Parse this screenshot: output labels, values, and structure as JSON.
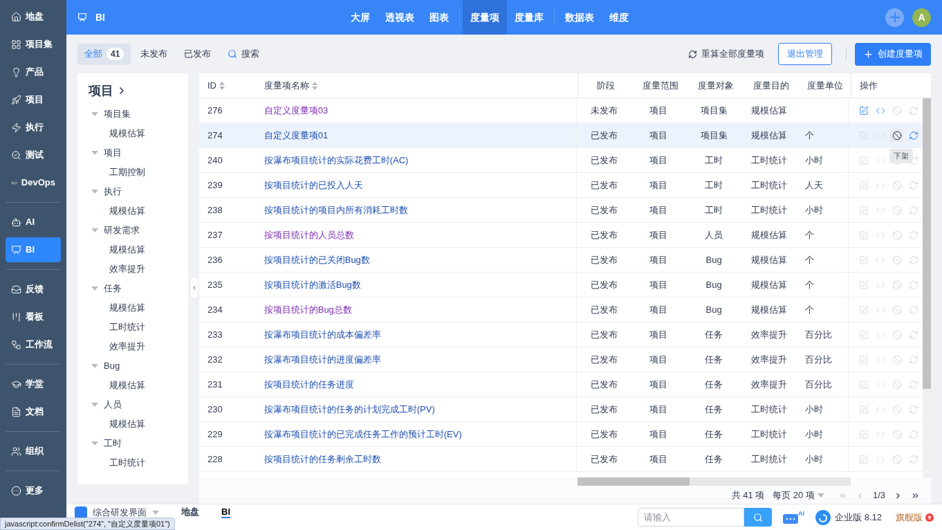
{
  "nav_groups": [
    [
      {
        "label": "地盘",
        "selected": false
      },
      {
        "label": "项目集",
        "selected": false
      },
      {
        "label": "产品",
        "selected": false
      },
      {
        "label": "项目",
        "selected": false
      },
      {
        "label": "执行",
        "selected": false
      },
      {
        "label": "测试",
        "selected": false
      },
      {
        "label": "DevOps",
        "selected": false
      }
    ],
    [
      {
        "label": "AI",
        "selected": false
      },
      {
        "label": "BI",
        "selected": true
      }
    ],
    [
      {
        "label": "反馈",
        "selected": false
      },
      {
        "label": "看板",
        "selected": false
      },
      {
        "label": "工作流",
        "selected": false
      }
    ],
    [
      {
        "label": "学堂",
        "selected": false
      },
      {
        "label": "文档",
        "selected": false
      }
    ],
    [
      {
        "label": "组织",
        "selected": false
      }
    ],
    [
      {
        "label": "更多",
        "selected": false
      }
    ]
  ],
  "header": {
    "title": "BI",
    "tab_groups": [
      [
        {
          "label": "大屏",
          "selected": false
        },
        {
          "label": "透视表",
          "selected": false
        },
        {
          "label": "图表",
          "selected": false
        }
      ],
      [
        {
          "label": "度量项",
          "selected": true
        },
        {
          "label": "度量库",
          "selected": false
        }
      ],
      [
        {
          "label": "数据表",
          "selected": false
        },
        {
          "label": "维度",
          "selected": false
        }
      ]
    ],
    "avatar": "A"
  },
  "filters": [
    {
      "label": "全部",
      "count": "41",
      "selected": true
    },
    {
      "label": "未发布",
      "selected": false
    },
    {
      "label": "已发布",
      "selected": false
    }
  ],
  "search_label": "搜索",
  "actions": {
    "recalc": "重算全部度量项",
    "exit": "退出管理",
    "create": "创建度量项"
  },
  "tree": {
    "title": "项目",
    "items": [
      {
        "label": "项目集",
        "children": [
          {
            "label": "规模估算"
          }
        ]
      },
      {
        "label": "项目",
        "children": [
          {
            "label": "工期控制"
          }
        ]
      },
      {
        "label": "执行",
        "children": [
          {
            "label": "规模估算"
          }
        ]
      },
      {
        "label": "研发需求",
        "children": [
          {
            "label": "规模估算"
          },
          {
            "label": "效率提升"
          }
        ]
      },
      {
        "label": "任务",
        "children": [
          {
            "label": "规模估算"
          },
          {
            "label": "工时统计"
          },
          {
            "label": "效率提升"
          }
        ]
      },
      {
        "label": "Bug",
        "children": [
          {
            "label": "规模估算"
          }
        ]
      },
      {
        "label": "人员",
        "children": [
          {
            "label": "规模估算"
          }
        ]
      },
      {
        "label": "工时",
        "children": [
          {
            "label": "工时统计"
          }
        ]
      }
    ]
  },
  "table": {
    "columns": [
      {
        "label": "ID",
        "sortable": true
      },
      {
        "label": "度量项名称",
        "sortable": true
      },
      {
        "label": "阶段",
        "sortable": false
      },
      {
        "label": "度量范围",
        "sortable": false
      },
      {
        "label": "度量对象",
        "sortable": false
      },
      {
        "label": "度量目的",
        "sortable": false
      },
      {
        "label": "度量单位",
        "sortable": false
      },
      {
        "label": "操作",
        "sortable": false
      }
    ],
    "rows": [
      {
        "id": "276",
        "name": "自定义度量项03",
        "visited": true,
        "stage": "未发布",
        "scope": "项目",
        "object": "项目集",
        "purpose": "规模估算",
        "unit": "",
        "hovered": false,
        "actions": [
          {
            "kind": "edit",
            "enabled": true
          },
          {
            "kind": "code",
            "enabled": true
          },
          {
            "kind": "delist",
            "enabled": false
          },
          {
            "kind": "recalc",
            "enabled": false
          }
        ]
      },
      {
        "id": "274",
        "name": "自定义度量项01",
        "visited": false,
        "stage": "已发布",
        "scope": "项目",
        "object": "项目集",
        "purpose": "规模估算",
        "unit": "个",
        "hovered": true,
        "actions": [
          {
            "kind": "edit",
            "enabled": false
          },
          {
            "kind": "code",
            "enabled": false
          },
          {
            "kind": "delist",
            "enabled": true,
            "tooltip": "下架"
          },
          {
            "kind": "recalc",
            "enabled": true
          }
        ]
      },
      {
        "id": "240",
        "name": "按瀑布项目统计的实际花费工时(AC)",
        "visited": false,
        "stage": "已发布",
        "scope": "项目",
        "object": "工时",
        "purpose": "工时统计",
        "unit": "小时",
        "hovered": false,
        "actions": [
          {
            "kind": "edit",
            "enabled": false
          },
          {
            "kind": "code",
            "enabled": false
          },
          {
            "kind": "delist",
            "enabled": false
          },
          {
            "kind": "recalc",
            "enabled": false
          }
        ]
      },
      {
        "id": "239",
        "name": "按项目统计的已投入人天",
        "visited": false,
        "stage": "已发布",
        "scope": "项目",
        "object": "工时",
        "purpose": "工时统计",
        "unit": "人天",
        "hovered": false,
        "actions": [
          {
            "kind": "edit",
            "enabled": false
          },
          {
            "kind": "code",
            "enabled": false
          },
          {
            "kind": "delist",
            "enabled": false
          },
          {
            "kind": "recalc",
            "enabled": false
          }
        ]
      },
      {
        "id": "238",
        "name": "按项目统计的项目内所有消耗工时数",
        "visited": false,
        "stage": "已发布",
        "scope": "项目",
        "object": "工时",
        "purpose": "工时统计",
        "unit": "小时",
        "hovered": false,
        "actions": [
          {
            "kind": "edit",
            "enabled": false
          },
          {
            "kind": "code",
            "enabled": false
          },
          {
            "kind": "delist",
            "enabled": false
          },
          {
            "kind": "recalc",
            "enabled": false
          }
        ]
      },
      {
        "id": "237",
        "name": "按项目统计的人员总数",
        "visited": true,
        "stage": "已发布",
        "scope": "项目",
        "object": "人员",
        "purpose": "规模估算",
        "unit": "个",
        "hovered": false,
        "actions": [
          {
            "kind": "edit",
            "enabled": false
          },
          {
            "kind": "code",
            "enabled": false
          },
          {
            "kind": "delist",
            "enabled": false
          },
          {
            "kind": "recalc",
            "enabled": false
          }
        ]
      },
      {
        "id": "236",
        "name": "按项目统计的已关闭Bug数",
        "visited": false,
        "stage": "已发布",
        "scope": "项目",
        "object": "Bug",
        "purpose": "规模估算",
        "unit": "个",
        "hovered": false,
        "actions": [
          {
            "kind": "edit",
            "enabled": false
          },
          {
            "kind": "code",
            "enabled": false
          },
          {
            "kind": "delist",
            "enabled": false
          },
          {
            "kind": "recalc",
            "enabled": false
          }
        ]
      },
      {
        "id": "235",
        "name": "按项目统计的激活Bug数",
        "visited": false,
        "stage": "已发布",
        "scope": "项目",
        "object": "Bug",
        "purpose": "规模估算",
        "unit": "个",
        "hovered": false,
        "actions": [
          {
            "kind": "edit",
            "enabled": false
          },
          {
            "kind": "code",
            "enabled": false
          },
          {
            "kind": "delist",
            "enabled": false
          },
          {
            "kind": "recalc",
            "enabled": false
          }
        ]
      },
      {
        "id": "234",
        "name": "按项目统计的Bug总数",
        "visited": true,
        "stage": "已发布",
        "scope": "项目",
        "object": "Bug",
        "purpose": "规模估算",
        "unit": "个",
        "hovered": false,
        "actions": [
          {
            "kind": "edit",
            "enabled": false
          },
          {
            "kind": "code",
            "enabled": false
          },
          {
            "kind": "delist",
            "enabled": false
          },
          {
            "kind": "recalc",
            "enabled": false
          }
        ]
      },
      {
        "id": "233",
        "name": "按瀑布项目统计的成本偏差率",
        "visited": false,
        "stage": "已发布",
        "scope": "项目",
        "object": "任务",
        "purpose": "效率提升",
        "unit": "百分比",
        "hovered": false,
        "actions": [
          {
            "kind": "edit",
            "enabled": false
          },
          {
            "kind": "code",
            "enabled": false
          },
          {
            "kind": "delist",
            "enabled": false
          },
          {
            "kind": "recalc",
            "enabled": false
          }
        ]
      },
      {
        "id": "232",
        "name": "按瀑布项目统计的进度偏差率",
        "visited": false,
        "stage": "已发布",
        "scope": "项目",
        "object": "任务",
        "purpose": "效率提升",
        "unit": "百分比",
        "hovered": false,
        "actions": [
          {
            "kind": "edit",
            "enabled": false
          },
          {
            "kind": "code",
            "enabled": false
          },
          {
            "kind": "delist",
            "enabled": false
          },
          {
            "kind": "recalc",
            "enabled": false
          }
        ]
      },
      {
        "id": "231",
        "name": "按项目统计的任务进度",
        "visited": false,
        "stage": "已发布",
        "scope": "项目",
        "object": "任务",
        "purpose": "效率提升",
        "unit": "百分比",
        "hovered": false,
        "actions": [
          {
            "kind": "edit",
            "enabled": false
          },
          {
            "kind": "code",
            "enabled": false
          },
          {
            "kind": "delist",
            "enabled": false
          },
          {
            "kind": "recalc",
            "enabled": false
          }
        ]
      },
      {
        "id": "230",
        "name": "按瀑布项目统计的任务的计划完成工时(PV)",
        "visited": false,
        "stage": "已发布",
        "scope": "项目",
        "object": "任务",
        "purpose": "工时统计",
        "unit": "小时",
        "hovered": false,
        "actions": [
          {
            "kind": "edit",
            "enabled": false
          },
          {
            "kind": "code",
            "enabled": false
          },
          {
            "kind": "delist",
            "enabled": false
          },
          {
            "kind": "recalc",
            "enabled": false
          }
        ]
      },
      {
        "id": "229",
        "name": "按瀑布项目统计的已完成任务工作的预计工时(EV)",
        "visited": false,
        "stage": "已发布",
        "scope": "项目",
        "object": "任务",
        "purpose": "工时统计",
        "unit": "小时",
        "hovered": false,
        "actions": [
          {
            "kind": "edit",
            "enabled": false
          },
          {
            "kind": "code",
            "enabled": false
          },
          {
            "kind": "delist",
            "enabled": false
          },
          {
            "kind": "recalc",
            "enabled": false
          }
        ]
      },
      {
        "id": "228",
        "name": "按项目统计的任务剩余工时数",
        "visited": false,
        "stage": "已发布",
        "scope": "项目",
        "object": "任务",
        "purpose": "工时统计",
        "unit": "小时",
        "hovered": false,
        "actions": [
          {
            "kind": "edit",
            "enabled": false
          },
          {
            "kind": "code",
            "enabled": false
          },
          {
            "kind": "delist",
            "enabled": false
          },
          {
            "kind": "recalc",
            "enabled": false
          }
        ]
      }
    ]
  },
  "pagination": {
    "total": "共 41 项",
    "per_page": "每页 20 项",
    "page": "1/3"
  },
  "taskbar": {
    "app": "综合研发界面",
    "tabs": [
      {
        "label": "地盘",
        "selected": false
      },
      {
        "label": "BI",
        "selected": true
      }
    ],
    "search_placeholder": "请输入",
    "ai_badge": "AI",
    "version": "企业版 8.12",
    "upgrade": "旗舰版"
  },
  "status_url": "javascript:confirmDelist(\"274\", \"自定义度量项01\")"
}
